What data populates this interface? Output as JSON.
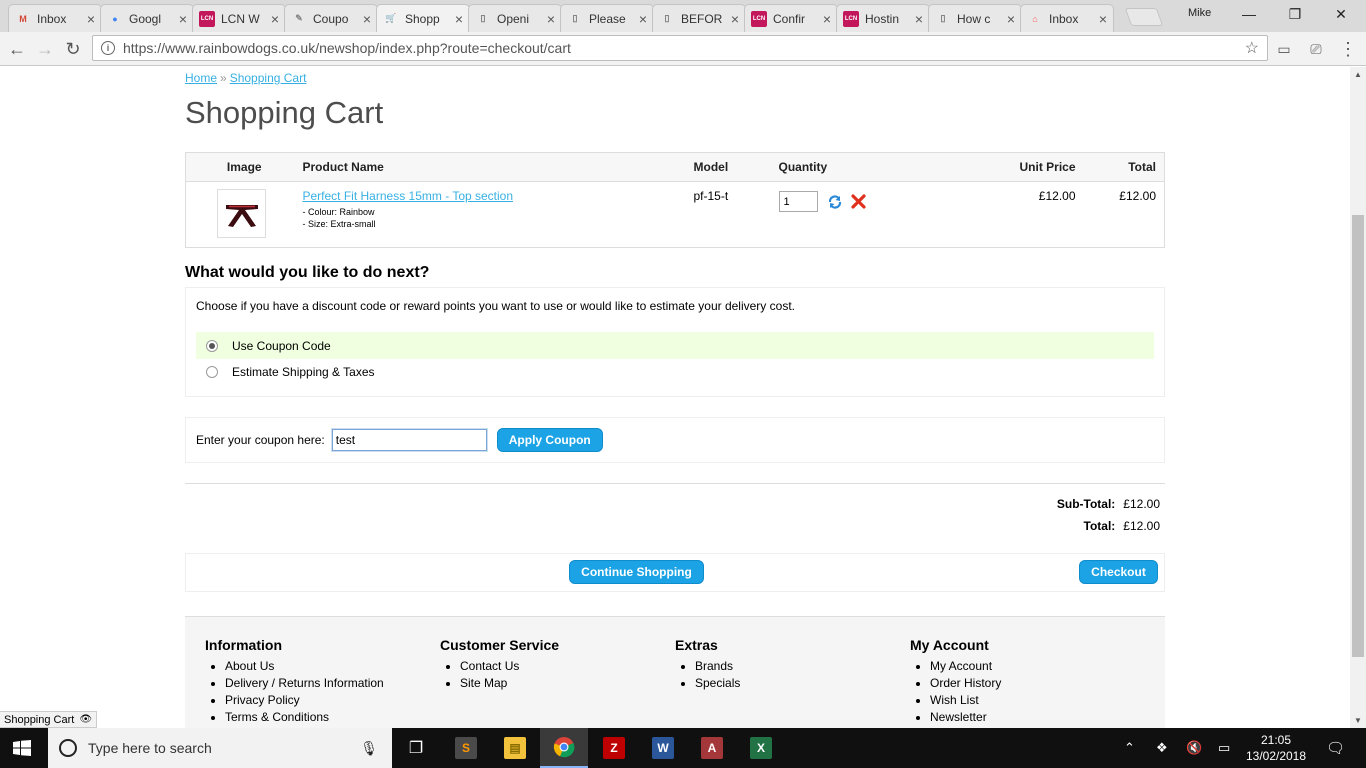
{
  "browser": {
    "tabs": [
      {
        "title": "Inbox",
        "icon": "gmail-icon",
        "color": "#d44638",
        "letter": "M"
      },
      {
        "title": "Googl",
        "icon": "google-account-icon",
        "color": "#4285f4",
        "letter": "●"
      },
      {
        "title": "LCN W",
        "icon": "lcn-icon",
        "color": "#c2185b",
        "letter": "LCN"
      },
      {
        "title": "Coupo",
        "icon": "coupon-icon",
        "color": "#888888",
        "letter": "✎"
      },
      {
        "title": "Shopp",
        "icon": "shopping-cart-icon",
        "color": "#555555",
        "letter": "🛒"
      },
      {
        "title": "Openi",
        "icon": "document-icon",
        "color": "#777777",
        "letter": "▯"
      },
      {
        "title": "Please",
        "icon": "document-icon",
        "color": "#777777",
        "letter": "▯"
      },
      {
        "title": "BEFOR",
        "icon": "document-icon",
        "color": "#777777",
        "letter": "▯"
      },
      {
        "title": "Confir",
        "icon": "lcn-icon",
        "color": "#c2185b",
        "letter": "LCN"
      },
      {
        "title": "Hostin",
        "icon": "lcn-icon",
        "color": "#c2185b",
        "letter": "LCN"
      },
      {
        "title": "How c",
        "icon": "document-icon",
        "color": "#777777",
        "letter": "▯"
      },
      {
        "title": "Inbox",
        "icon": "airbnb-icon",
        "color": "#ff5a5f",
        "letter": "⌂"
      }
    ],
    "active_tab": 4,
    "profile": "Mike",
    "url": "https://www.rainbowdogs.co.uk/newshop/index.php?route=checkout/cart"
  },
  "breadcrumb": {
    "home": "Home",
    "sep": "»",
    "current": "Shopping Cart"
  },
  "page_title": "Shopping Cart",
  "cart": {
    "headers": {
      "image": "Image",
      "name": "Product Name",
      "model": "Model",
      "quantity": "Quantity",
      "unit_price": "Unit Price",
      "total": "Total"
    },
    "items": [
      {
        "name": "Perfect Fit Harness 15mm - Top section",
        "option1": "- Colour: Rainbow",
        "option2": "- Size: Extra-small",
        "model": "pf-15-t",
        "quantity": "1",
        "unit_price": "£12.00",
        "total": "£12.00"
      }
    ]
  },
  "next": {
    "heading": "What would you like to do next?",
    "intro": "Choose if you have a discount code or reward points you want to use or would like to estimate your delivery cost.",
    "options": [
      "Use Coupon Code",
      "Estimate Shipping & Taxes"
    ],
    "selected": 0
  },
  "coupon": {
    "label": "Enter your coupon here:",
    "value": "test",
    "button": "Apply Coupon"
  },
  "totals": {
    "subtotal_label": "Sub-Total:",
    "subtotal": "£12.00",
    "total_label": "Total:",
    "total": "£12.00"
  },
  "actions": {
    "continue": "Continue Shopping",
    "checkout": "Checkout"
  },
  "footer": {
    "information": {
      "title": "Information",
      "links": [
        "About Us",
        "Delivery / Returns Information",
        "Privacy Policy",
        "Terms & Conditions"
      ]
    },
    "customer_service": {
      "title": "Customer Service",
      "links": [
        "Contact Us",
        "Site Map"
      ]
    },
    "extras": {
      "title": "Extras",
      "links": [
        "Brands",
        "Specials"
      ]
    },
    "my_account": {
      "title": "My Account",
      "links": [
        "My Account",
        "Order History",
        "Wish List",
        "Newsletter"
      ]
    }
  },
  "status_bar": "Shopping Cart",
  "taskbar": {
    "search_placeholder": "Type here to search",
    "time": "21:05",
    "date": "13/02/2018"
  }
}
